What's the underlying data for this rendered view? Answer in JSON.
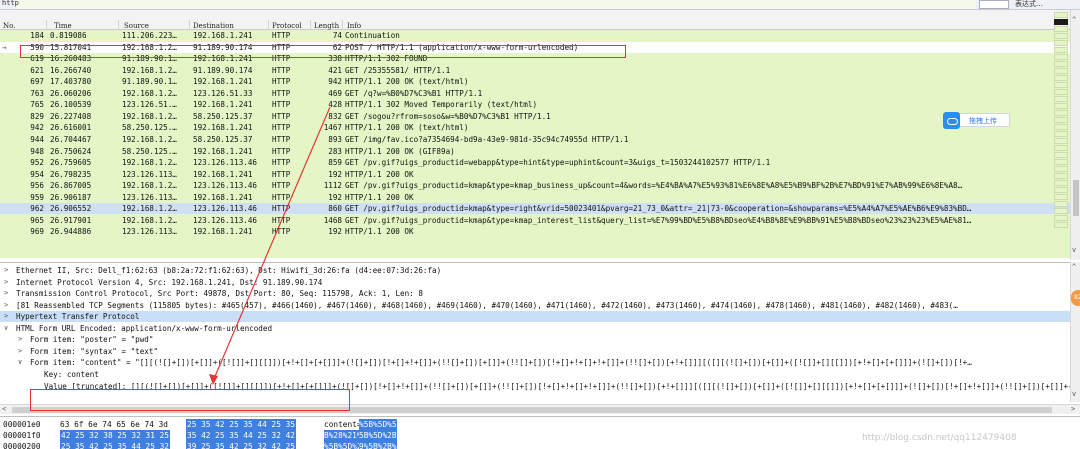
{
  "filter": {
    "value": "http",
    "right_label": "表达式…"
  },
  "packet_list": {
    "headers": [
      "No.",
      "Time",
      "Source",
      "Destination",
      "Protocol",
      "Length",
      "Info"
    ],
    "rows": [
      {
        "no": "184",
        "time": "0.819086",
        "src": "111.206.223…",
        "dst": "192.168.1.241",
        "proto": "HTTP",
        "len": "74",
        "info": "Continuation"
      },
      {
        "no": "590",
        "time": "15.817041",
        "src": "192.168.1.2…",
        "dst": "91.189.90.174",
        "proto": "HTTP",
        "len": "62",
        "info": "POST / HTTP/1.1  (application/x-www-form-urlencoded)"
      },
      {
        "no": "619",
        "time": "16.260483",
        "src": "91.189.90.1…",
        "dst": "192.168.1.241",
        "proto": "HTTP",
        "len": "338",
        "info": "HTTP/1.1 302 FOUND"
      },
      {
        "no": "621",
        "time": "16.266740",
        "src": "192.168.1.2…",
        "dst": "91.189.90.174",
        "proto": "HTTP",
        "len": "421",
        "info": "GET /25355581/ HTTP/1.1"
      },
      {
        "no": "697",
        "time": "17.403780",
        "src": "91.189.90.1…",
        "dst": "192.168.1.241",
        "proto": "HTTP",
        "len": "942",
        "info": "HTTP/1.1 200 OK  (text/html)"
      },
      {
        "no": "763",
        "time": "26.060206",
        "src": "192.168.1.2…",
        "dst": "123.126.51.33",
        "proto": "HTTP",
        "len": "469",
        "info": "GET /q?w=%B0%D7%C3%B1 HTTP/1.1"
      },
      {
        "no": "765",
        "time": "26.100539",
        "src": "123.126.51.…",
        "dst": "192.168.1.241",
        "proto": "HTTP",
        "len": "428",
        "info": "HTTP/1.1 302 Moved Temporarily  (text/html)"
      },
      {
        "no": "829",
        "time": "26.227408",
        "src": "192.168.1.2…",
        "dst": "58.250.125.37",
        "proto": "HTTP",
        "len": "832",
        "info": "GET /sogou?rfrom=soso&w=%B0%D7%C3%B1 HTTP/1.1"
      },
      {
        "no": "942",
        "time": "26.616001",
        "src": "58.250.125.…",
        "dst": "192.168.1.241",
        "proto": "HTTP",
        "len": "1467",
        "info": "HTTP/1.1 200 OK  (text/html)"
      },
      {
        "no": "944",
        "time": "26.704467",
        "src": "192.168.1.2…",
        "dst": "58.250.125.37",
        "proto": "HTTP",
        "len": "893",
        "info": "GET /img/fav.ico?a7354694-bd9a-43e9-981d-35c94c74955d HTTP/1.1"
      },
      {
        "no": "948",
        "time": "26.750624",
        "src": "58.250.125.…",
        "dst": "192.168.1.241",
        "proto": "HTTP",
        "len": "283",
        "info": "HTTP/1.1 200 OK  (GIF89a)"
      },
      {
        "no": "952",
        "time": "26.759605",
        "src": "192.168.1.2…",
        "dst": "123.126.113.46",
        "proto": "HTTP",
        "len": "859",
        "info": "GET /pv.gif?uigs_productid=webapp&type=hint&type=uphint&count=3&uigs_t=1503244102577 HTTP/1.1"
      },
      {
        "no": "954",
        "time": "26.798235",
        "src": "123.126.113…",
        "dst": "192.168.1.241",
        "proto": "HTTP",
        "len": "192",
        "info": "HTTP/1.1 200 OK"
      },
      {
        "no": "956",
        "time": "26.867005",
        "src": "192.168.1.2…",
        "dst": "123.126.113.46",
        "proto": "HTTP",
        "len": "1112",
        "info": "GET /pv.gif?uigs_productid=kmap&type=kmap_business_up&count=4&words=%E4%BA%A7%E5%93%81%E6%8E%A8%E5%B9%BF%2B%E7%BD%91%E7%AB%99%E6%8E%A8…"
      },
      {
        "no": "959",
        "time": "26.906187",
        "src": "123.126.113…",
        "dst": "192.168.1.241",
        "proto": "HTTP",
        "len": "192",
        "info": "HTTP/1.1 200 OK"
      },
      {
        "no": "962",
        "time": "26.906552",
        "src": "192.168.1.2…",
        "dst": "123.126.113.46",
        "proto": "HTTP",
        "len": "860",
        "info": "GET /pv.gif?uigs_productid=kmap&type=right&vrid=50023401&pvarg=21_73_0&attr=_21|73-0&cooperation=&showparams=%E5%A4%A7%E5%AE%B6%E9%83%BD…"
      },
      {
        "no": "965",
        "time": "26.917901",
        "src": "192.168.1.2…",
        "dst": "123.126.113.46",
        "proto": "HTTP",
        "len": "1468",
        "info": "GET /pv.gif?uigs_productid=kmap&type=kmap_interest_list&query_list=%E7%99%BD%E5%B8%BDseo%E4%B8%8E%E9%BB%91%E5%B8%BDseo%23%23%23%E5%AE%81…"
      },
      {
        "no": "969",
        "time": "26.944886",
        "src": "123.126.113…",
        "dst": "192.168.1.241",
        "proto": "HTTP",
        "len": "192",
        "info": "HTTP/1.1 200 OK"
      }
    ]
  },
  "upload_button": {
    "label": "拖拽上传"
  },
  "details": {
    "rows": [
      {
        "twisty": ">",
        "text": "Ethernet II, Src: Dell_f1:62:63 (b8:2a:72:f1:62:63), Dst: Hiwifi_3d:26:fa (d4:ee:07:3d:26:fa)"
      },
      {
        "twisty": ">",
        "text": "Internet Protocol Version 4, Src: 192.168.1.241, Dst: 91.189.90.174"
      },
      {
        "twisty": ">",
        "text": "Transmission Control Protocol, Src Port: 49878, Dst Port: 80, Seq: 115798, Ack: 1, Len: 8"
      },
      {
        "twisty": ">",
        "text": "[81 Reassembled TCP Segments (115805 bytes): #465(457), #466(1460), #467(1460), #468(1460), #469(1460), #470(1460), #471(1460), #472(1460), #473(1460), #474(1460), #478(1460), #481(1460), #482(1460), #483(…"
      },
      {
        "twisty": ">",
        "text": "Hypertext Transfer Protocol"
      },
      {
        "twisty": "∨",
        "text": "HTML Form URL Encoded: application/x-www-form-urlencoded"
      },
      {
        "twisty": ">",
        "text": "Form item: \"poster\" = \"pwd\""
      },
      {
        "twisty": ">",
        "text": "Form item: \"syntax\" = \"text\""
      },
      {
        "twisty": "∨",
        "text": "Form item: \"content\" = \"[][(![]+[])[+[]]+([![]]+[][[]])[+!+[]+[+[]]]+(![]+[])[!+[]+!+[]]+(!![]+[])[+[]]+(!![]+[])[!+[]+!+[]+!+[]]+(!![]+[])[+!+[]]][([][(![]+[])[+[]]+([![]]+[][[]])[+!+[]+[+[]]]+(![]+[])[!+…"
      },
      {
        "twisty": "",
        "text": "Key: content"
      },
      {
        "twisty": "",
        "text": "Value [truncated]: [][(![]+[])[+[]]+([![]]+[][[]])[+!+[]+[+[]]]+(![]+[])[!+[]+!+[]]+(!![]+[])[+[]]+(!![]+[])[!+[]+!+[]+!+[]]+(!![]+[])[+!+[]]][([][(![]+[])[+[]]+([![]]+[][[]])[+!+[]+[+[]]]+(![]+[])[!+[]+!+[]]+(!![]+[])[+[]]+(!![]+[])[!+"
      }
    ]
  },
  "side_badge": "82",
  "bytes": {
    "rows": [
      {
        "offset": "000001e0",
        "hex1": "63 6f 6e 74 65 6e 74 3d",
        "hex2": "25 35 42 25 35 44 25 35",
        "ascii1": "content=",
        "ascii2": "%5B%5D%5"
      },
      {
        "offset": "000001f0",
        "hex1": "42 25 32 38 25 32 31 25",
        "hex2": "35 42 25 35 44 25 32 42",
        "ascii1": "B%28%21%",
        "ascii2": "5B%5D%2B"
      },
      {
        "offset": "00000200",
        "hex1": "25 35 42 25 35 44 25 32",
        "hex2": "39 25 35 42 25 32 42 25",
        "ascii1": "%5B%5D%2",
        "ascii2": "9%5B%2B%"
      }
    ]
  },
  "watermark": "http://blog.csdn.net/qq112479408"
}
